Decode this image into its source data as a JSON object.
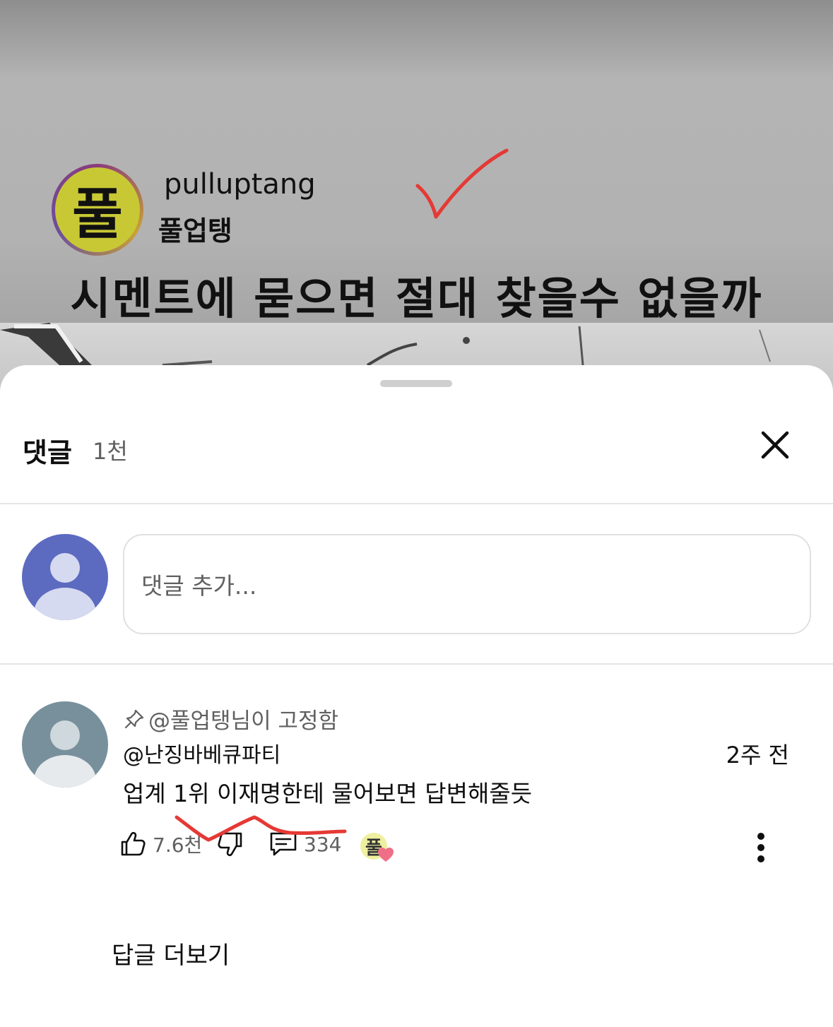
{
  "video": {
    "channel_logo_text": "풀",
    "channel_handle": "pulluptang",
    "channel_name": "풀업탱",
    "caption": "시멘트에 묻으면 절대 찾을수 없을까"
  },
  "sheet": {
    "title": "댓글",
    "count": "1천",
    "close_icon": "close-icon"
  },
  "composer": {
    "placeholder": "댓글 추가...",
    "avatar_color": "#5c6bc0"
  },
  "comment": {
    "pinned_label": "@풀업탱님이 고정함",
    "author": "@난징바베큐파티",
    "time": "2주 전",
    "text": "업계 1위 이재명한테 물어보면 답변해줄듯",
    "likes": "7.6천",
    "replies_count": "334",
    "creator_heart_text": "풀",
    "avatar_color": "#78909c",
    "view_replies": "답글 더보기"
  },
  "colors": {
    "annotation_red": "#e53935",
    "divider": "#e5e5e5",
    "secondary_text": "#606060"
  }
}
